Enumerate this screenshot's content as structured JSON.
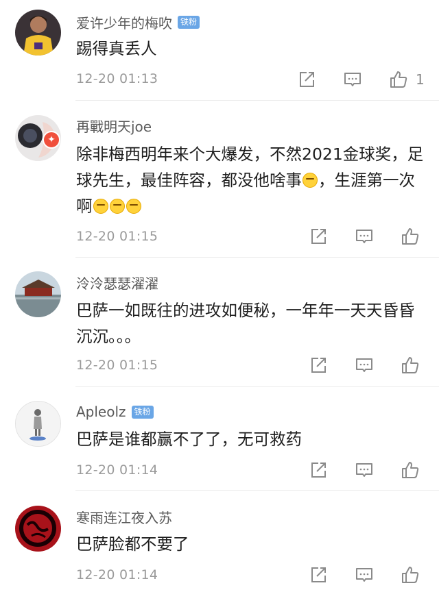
{
  "comments": [
    {
      "username": "爱许少年的梅吹",
      "badge": "铁粉",
      "text": "踢得真丢人",
      "time": "12-20 01:13",
      "like_count": "1"
    },
    {
      "username": "再戰明天joe",
      "badge": "",
      "text_parts": [
        "除非梅西明年来个大爆发，不然2021金球奖，足球先生，最佳阵容，都没他啥事",
        "，生涯第一次啊"
      ],
      "emoji_laugh": "laughing-tears-emoji",
      "emoji_smirk": "smirk-emoji",
      "time": "12-20 01:15",
      "like_count": ""
    },
    {
      "username": "泠泠瑟瑟濯濯",
      "badge": "",
      "text": "巴萨一如既往的进攻如便秘，一年年一天天昏昏沉沉。。。",
      "time": "12-20 01:15",
      "like_count": ""
    },
    {
      "username": "Apleolz",
      "badge": "铁粉",
      "text": "巴萨是谁都赢不了了，无可救药",
      "time": "12-20 01:14",
      "like_count": ""
    },
    {
      "username": "寒雨连江夜入苏",
      "badge": "",
      "text": "巴萨脸都不要了",
      "time": "12-20 01:14",
      "like_count": ""
    }
  ],
  "icons": {
    "share": "share-icon",
    "comment": "comment-icon",
    "like": "thumbs-up-icon"
  },
  "colors": {
    "badge_blue": "#6aa6e6",
    "text": "#1e1e1e",
    "meta": "#9a9a9a",
    "verified_red": "#f04f3c"
  }
}
